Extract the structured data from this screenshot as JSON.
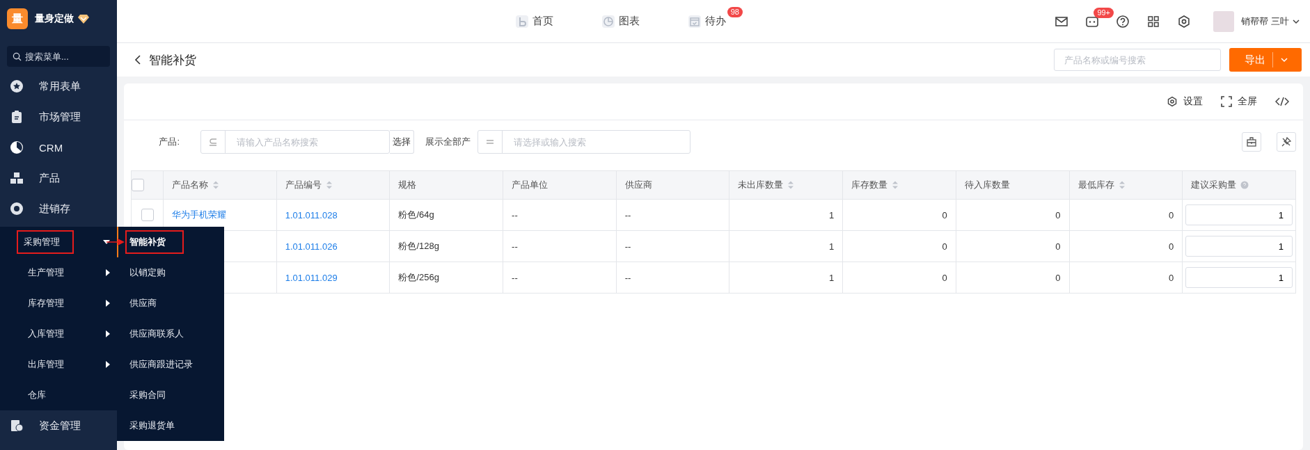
{
  "sidebar": {
    "logo": "量",
    "brand": "量身定做",
    "search_placeholder": "搜索菜单...",
    "items": [
      {
        "label": "常用表单"
      },
      {
        "label": "市场管理"
      },
      {
        "label": "CRM"
      },
      {
        "label": "产品"
      },
      {
        "label": "进销存"
      },
      {
        "label": "资金管理"
      }
    ]
  },
  "flyout": {
    "groups": [
      {
        "label": "采购管理",
        "submenu": true,
        "expanded": true,
        "marked": true
      },
      {
        "label": "生产管理",
        "submenu": true,
        "expanded": false,
        "marked": false
      },
      {
        "label": "库存管理",
        "submenu": true,
        "expanded": false,
        "marked": false
      },
      {
        "label": "入库管理",
        "submenu": true,
        "expanded": false,
        "marked": false
      },
      {
        "label": "出库管理",
        "submenu": true,
        "expanded": false,
        "marked": false
      },
      {
        "label": "仓库",
        "submenu": false,
        "marked": false
      }
    ],
    "subitems": [
      {
        "label": "智能补货",
        "selected": true,
        "marked": true
      },
      {
        "label": "以销定购",
        "selected": false,
        "marked": false
      },
      {
        "label": "供应商",
        "selected": false,
        "marked": false
      },
      {
        "label": "供应商联系人",
        "selected": false,
        "marked": false
      },
      {
        "label": "供应商跟进记录",
        "selected": false,
        "marked": false
      },
      {
        "label": "采购合同",
        "selected": false,
        "marked": false
      },
      {
        "label": "采购退货单",
        "selected": false,
        "marked": false
      }
    ]
  },
  "topnav": [
    {
      "label": "首页"
    },
    {
      "label": "图表"
    },
    {
      "label": "待办",
      "badge": "98"
    }
  ],
  "header_tools": {
    "chat_badge": "99+",
    "user": "销帮帮 三叶"
  },
  "page": {
    "title": "智能补货",
    "search_placeholder": "产品名称或编号搜索",
    "export_button": "导出"
  },
  "toolbar": [
    {
      "label": "设置"
    },
    {
      "label": "全屏"
    }
  ],
  "filters": {
    "product_label": "产品:",
    "product_placeholder": "请输入产品名称搜索",
    "select_button": "选择",
    "dept_label": "展示全部产",
    "dept_placeholder": "请选择或输入搜索"
  },
  "table": {
    "select_all_checked": false,
    "columns": [
      {
        "label": "产品名称",
        "sortable": true,
        "help": false
      },
      {
        "label": "产品编号",
        "sortable": true,
        "help": false
      },
      {
        "label": "规格",
        "sortable": false,
        "help": false
      },
      {
        "label": "产品单位",
        "sortable": false,
        "help": false
      },
      {
        "label": "供应商",
        "sortable": false,
        "help": false
      },
      {
        "label": "未出库数量",
        "sortable": true,
        "help": false
      },
      {
        "label": "库存数量",
        "sortable": true,
        "help": false
      },
      {
        "label": "待入库数量",
        "sortable": false,
        "help": false
      },
      {
        "label": "最低库存",
        "sortable": true,
        "help": false
      },
      {
        "label": "建议采购量",
        "sortable": false,
        "help": true
      }
    ],
    "rows": [
      {
        "checked": false,
        "cells": [
          "华为手机荣耀",
          "1.01.011.028",
          "粉色/64g",
          "--",
          "--",
          "1",
          "0",
          "0",
          "0"
        ],
        "suggested": "1"
      },
      {
        "cells": [
          "",
          "1.01.011.026",
          "粉色/128g",
          "--",
          "--",
          "1",
          "0",
          "0",
          "0"
        ],
        "suggested": "1"
      },
      {
        "cells": [
          "",
          "1.01.011.029",
          "粉色/256g",
          "--",
          "--",
          "1",
          "0",
          "0",
          "0"
        ],
        "suggested": "1"
      }
    ]
  }
}
